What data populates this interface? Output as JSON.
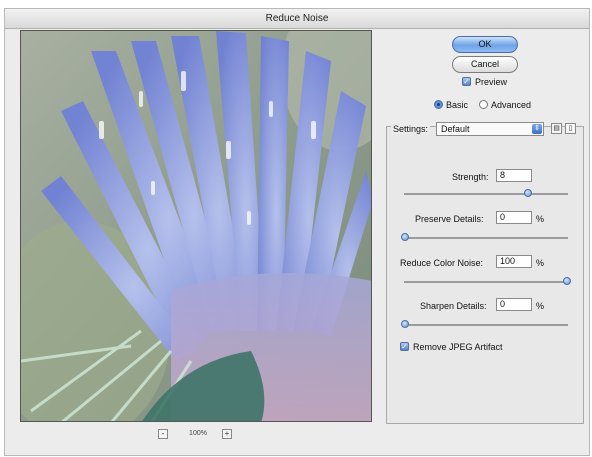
{
  "window": {
    "title": "Reduce Noise"
  },
  "buttons": {
    "ok": "OK",
    "cancel": "Cancel"
  },
  "preview": {
    "label": "Preview",
    "checked": true
  },
  "mode": {
    "basic": "Basic",
    "advanced": "Advanced",
    "selected": "Basic"
  },
  "settings": {
    "label": "Settings:",
    "value": "Default"
  },
  "sliders": [
    {
      "label": "Strength:",
      "value": "8",
      "unit": "",
      "level": 0.8
    },
    {
      "label": "Preserve Details:",
      "value": "0",
      "unit": "%",
      "level": 0.0
    },
    {
      "label": "Reduce Color Noise:",
      "value": "100",
      "unit": "%",
      "level": 1.0
    },
    {
      "label": "Sharpen Details:",
      "value": "0",
      "unit": "%",
      "level": 0.0
    }
  ],
  "jpeg": {
    "label": "Remove JPEG Artifact",
    "checked": true
  },
  "zoom": {
    "value": "100%",
    "minus": "-",
    "plus": "+"
  },
  "icons": {
    "save": "save-settings-icon",
    "delete": "trash-icon",
    "preview_image": "flower-image"
  }
}
